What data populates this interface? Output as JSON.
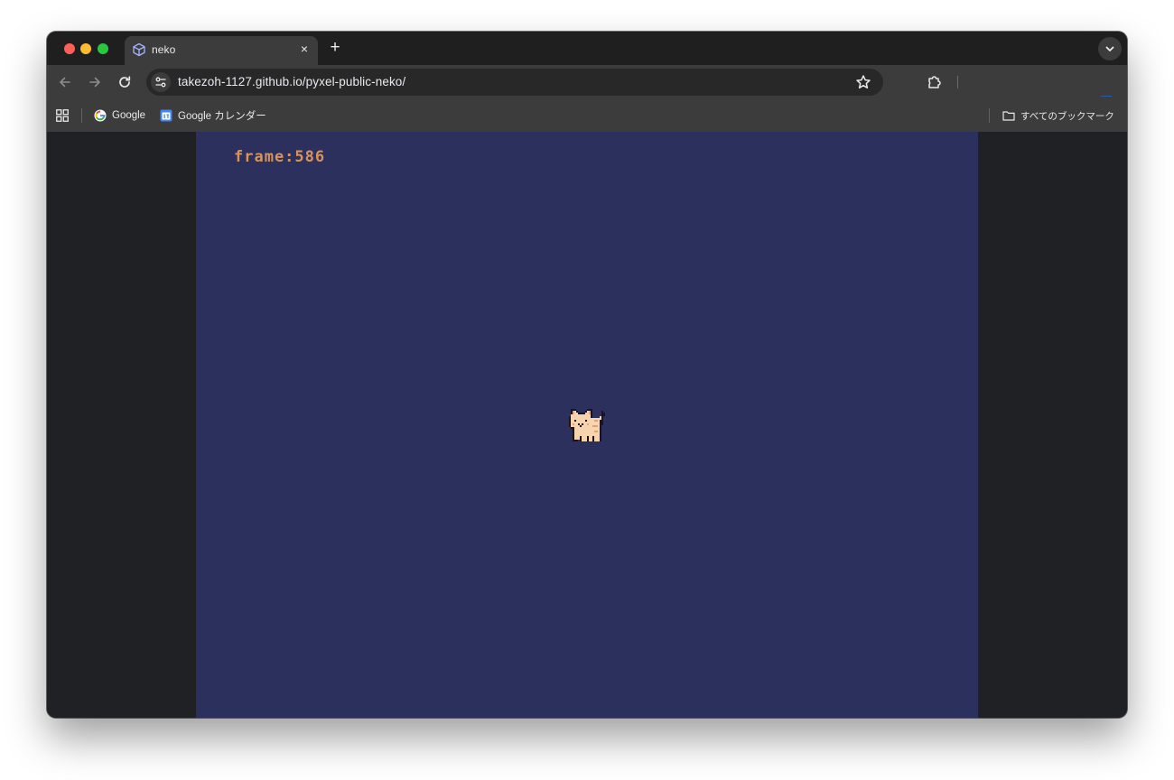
{
  "browser": {
    "tab": {
      "title": "neko",
      "favicon": "cube-icon",
      "close_glyph": "×"
    },
    "new_tab_glyph": "+",
    "address_bar": {
      "url": "takezoh-1127.github.io/pyxel-public-neko/"
    },
    "bookmarks": {
      "items": [
        {
          "label": "Google",
          "icon": "google-icon"
        },
        {
          "label": "Google カレンダー",
          "icon": "calendar-icon"
        }
      ],
      "all_bookmarks_label": "すべてのブックマーク"
    }
  },
  "game": {
    "frame_text": "frame:586",
    "sprite": "cat-sprite",
    "colors": {
      "background": "#2b305d",
      "text": "#d8935c"
    }
  }
}
